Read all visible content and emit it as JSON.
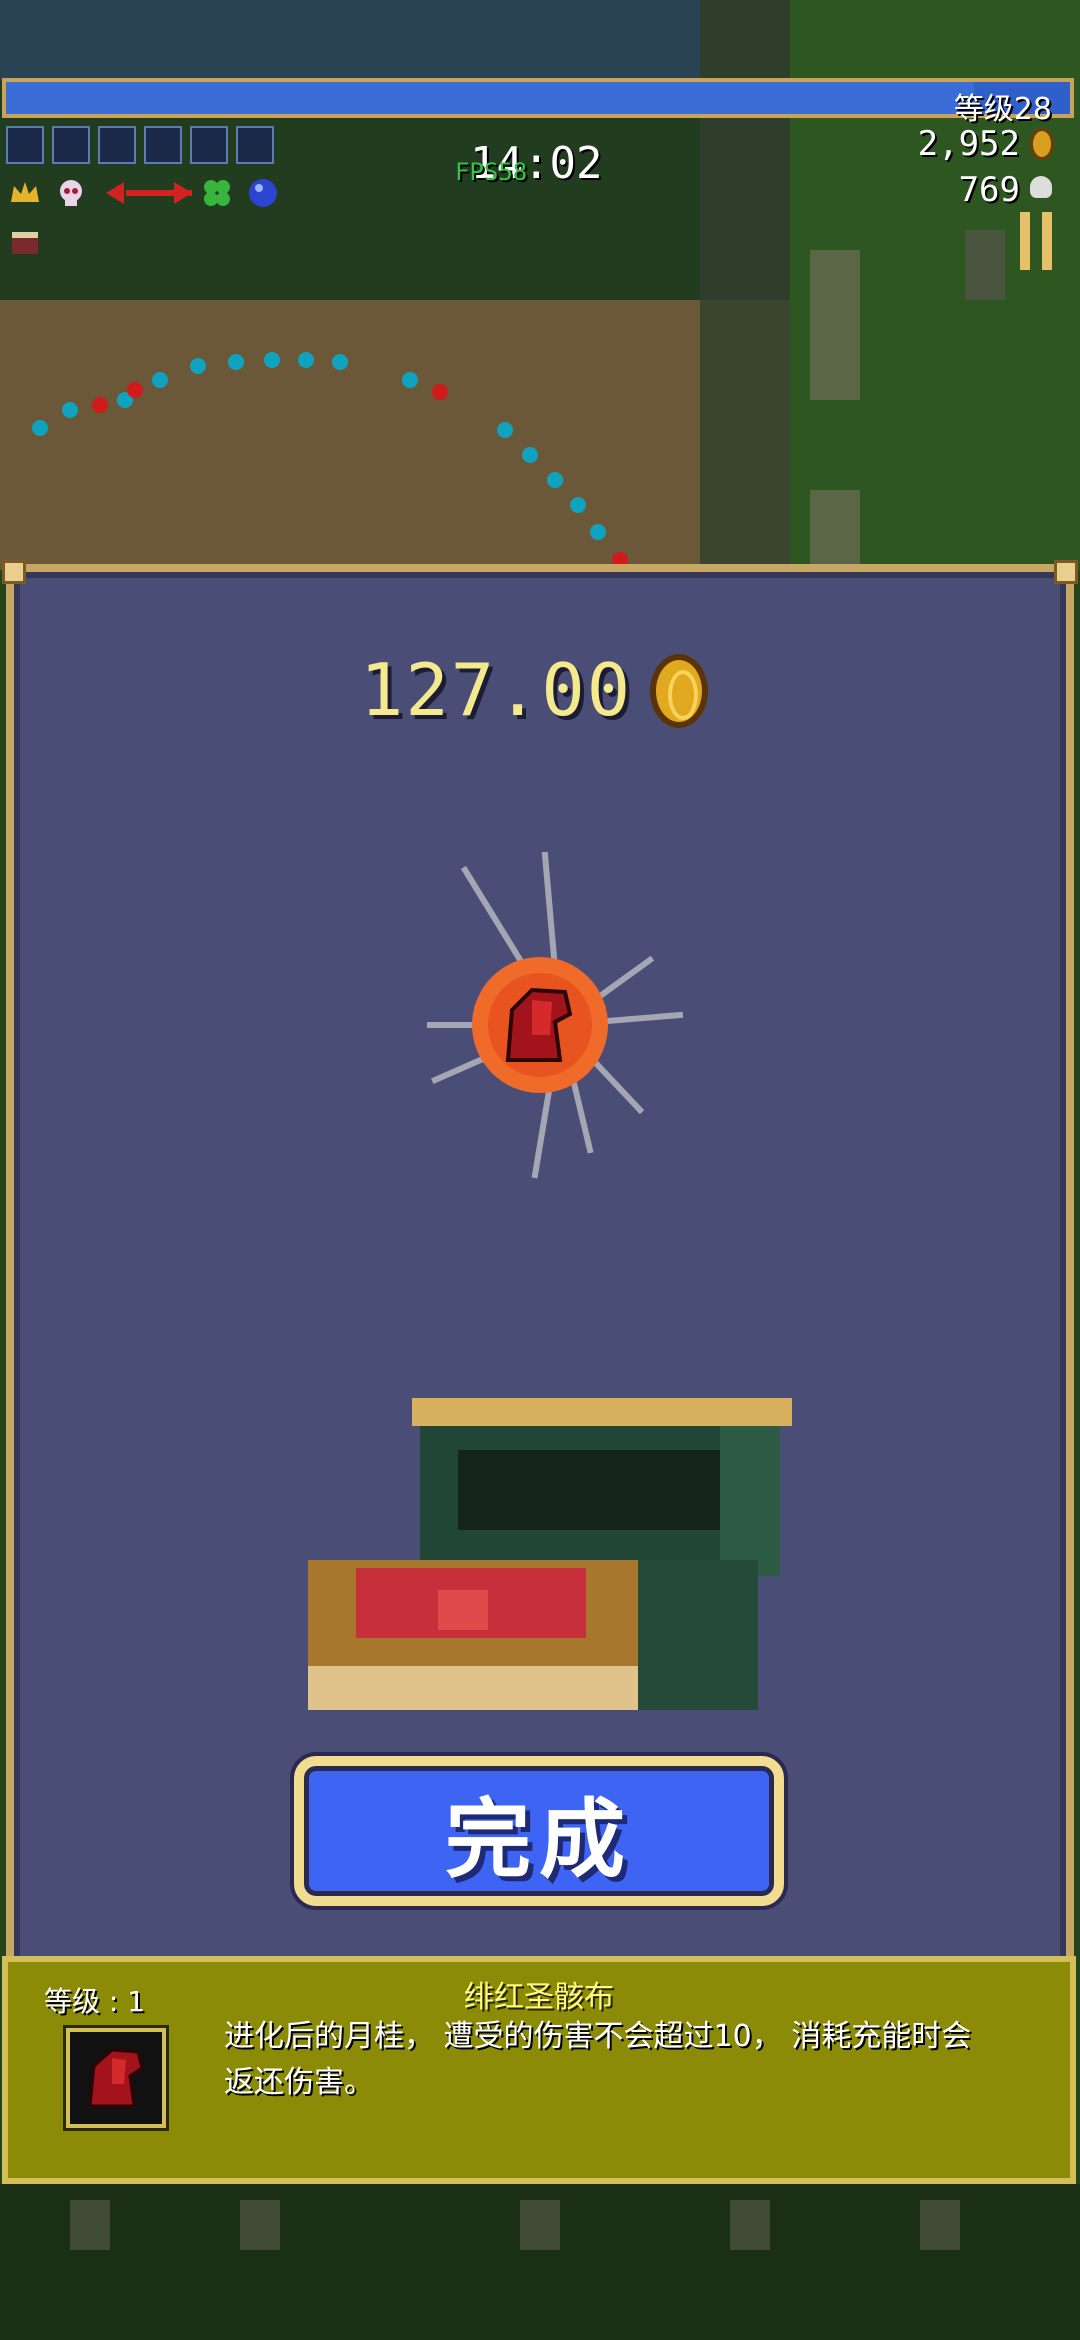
{
  "hud": {
    "level_label": "等级28",
    "xp_progress": 0.91,
    "timer": "14:02",
    "fps_label": "FPS58",
    "gold_count": "2,952",
    "kill_count": "769",
    "icons": [
      "gold-coin-icon",
      "skull-icon",
      "pause-icon"
    ]
  },
  "reward": {
    "amount": "127.00",
    "item_name": "绯红圣骸布",
    "item_level": "等级 : 1",
    "item_description": "进化后的月桂，  遭受的伤害不会超过10，  消耗充能时会返还伤害。"
  },
  "buttons": {
    "done_label": "完成"
  },
  "colors": {
    "panel_bg": "#4a4e77",
    "panel_border": "#c6a764",
    "button_blue": "#3d64f2",
    "amount_yellow": "#f4e98c",
    "info_olive": "#8b8b08",
    "xp_blue": "#2f5fc9"
  }
}
